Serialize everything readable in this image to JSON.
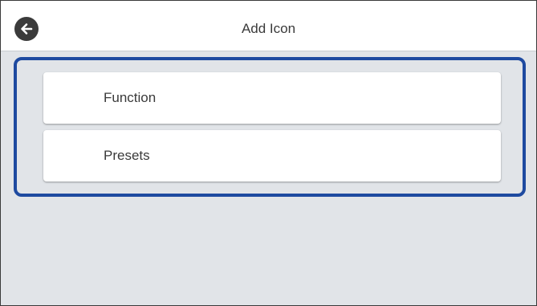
{
  "header": {
    "title": "Add Icon",
    "back_icon": "back-arrow-icon"
  },
  "menu": {
    "items": [
      {
        "label": "Function"
      },
      {
        "label": "Presets"
      }
    ]
  },
  "colors": {
    "background": "#e1e4e8",
    "header_background": "#ffffff",
    "selection_outline": "#1e4aa0",
    "back_button": "#3b3b3b",
    "text": "#3a3a3a"
  }
}
